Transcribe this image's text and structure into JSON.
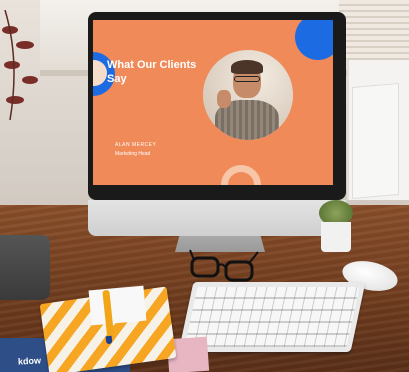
{
  "slide": {
    "title": "What Our Clients Say",
    "person_name": "ALAN MERCEY",
    "person_role": "Marketing Head"
  },
  "book": {
    "text": "kdow"
  },
  "colors": {
    "slide_background": "#f08a58",
    "slide_accent": "#1d6be3",
    "desk": "#7a4524",
    "notebook_stripe": "#f6a623"
  }
}
